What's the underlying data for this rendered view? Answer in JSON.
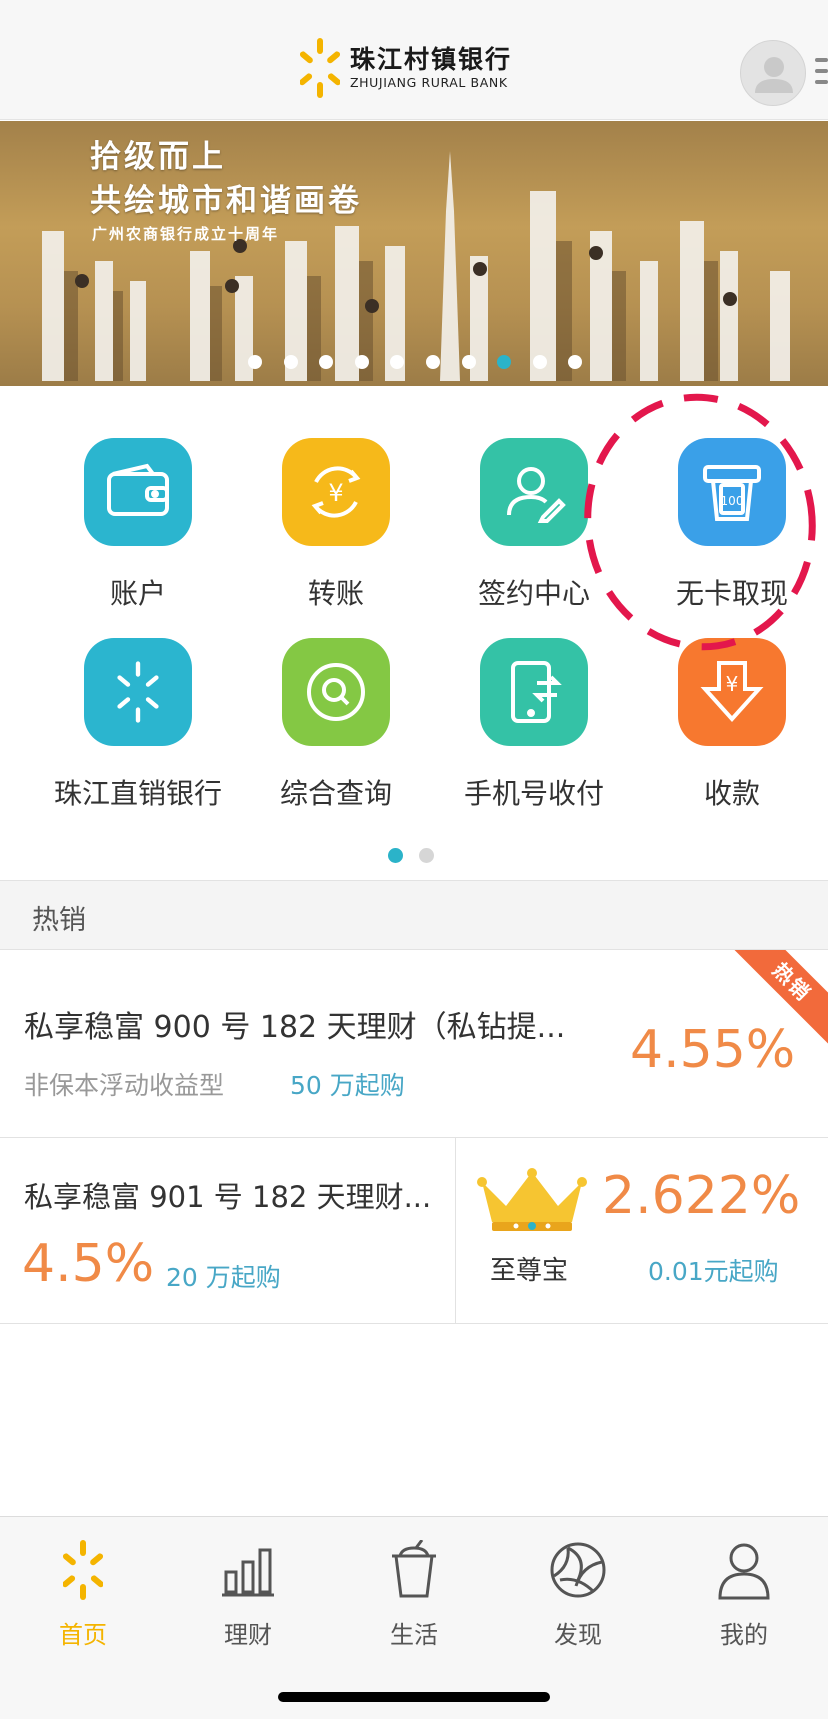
{
  "header": {
    "bank_name_cn": "珠江村镇银行",
    "bank_name_en": "ZHUJIANG RURAL BANK",
    "brand_color": "#f4b400"
  },
  "banner": {
    "title_line1": "拾级而上",
    "title_line2": "共绘城市和谐画卷",
    "subtitle": "广州农商银行成立十周年",
    "slide_count": 10,
    "active_slide": 8
  },
  "services": [
    {
      "label": "账户",
      "icon": "wallet-icon",
      "color": "#2bb5cf"
    },
    {
      "label": "转账",
      "icon": "transfer-yuan-icon",
      "color": "#f6b91a"
    },
    {
      "label": "签约中心",
      "icon": "user-sign-icon",
      "color": "#34c2a6"
    },
    {
      "label": "无卡取现",
      "icon": "cardless-cash-icon",
      "color": "#3aa0e8"
    },
    {
      "label": "珠江直销银行",
      "icon": "direct-bank-icon",
      "color": "#2bb5cf"
    },
    {
      "label": "综合查询",
      "icon": "query-search-icon",
      "color": "#84c844"
    },
    {
      "label": "手机号收付",
      "icon": "phone-transfer-icon",
      "color": "#34c2a6"
    },
    {
      "label": "收款",
      "icon": "receive-money-icon",
      "color": "#f7782f"
    }
  ],
  "services_pager": {
    "pages": 2,
    "active": 1
  },
  "hot": {
    "section_title": "热销",
    "badge": "热销",
    "products": [
      {
        "name": "私享稳富 900 号 182 天理财（私钻提...",
        "type": "非保本浮动收益型",
        "min": "50 万起购",
        "rate": "4.55%"
      },
      {
        "name": "私享稳富 901 号 182 天理财...",
        "rate": "4.5%",
        "min": "20 万起购"
      },
      {
        "name": "至尊宝",
        "rate": "2.622%",
        "min": "0.01元起购",
        "icon": "crown-icon"
      }
    ]
  },
  "tabs": [
    {
      "label": "首页",
      "icon": "home-logo-icon",
      "active": true
    },
    {
      "label": "理财",
      "icon": "bar-chart-icon",
      "active": false
    },
    {
      "label": "生活",
      "icon": "cup-icon",
      "active": false
    },
    {
      "label": "发现",
      "icon": "discover-aperture-icon",
      "active": false
    },
    {
      "label": "我的",
      "icon": "profile-icon",
      "active": false
    }
  ]
}
